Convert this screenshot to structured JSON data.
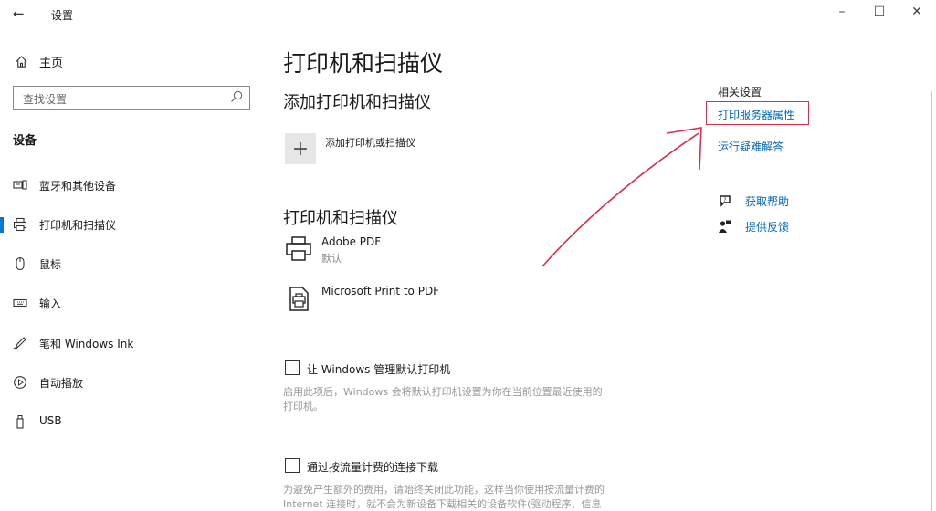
{
  "window": {
    "back_glyph": "←",
    "title": "设置",
    "minimize_glyph": "–",
    "maximize_glyph": "☐",
    "close_glyph": "✕"
  },
  "nav": {
    "home_label": "主页",
    "search_placeholder": "查找设置",
    "section_label": "设备",
    "items": [
      {
        "label": "蓝牙和其他设备",
        "icon": "keyboard-phone-icon"
      },
      {
        "label": "打印机和扫描仪",
        "icon": "printer-icon",
        "active": true
      },
      {
        "label": "鼠标",
        "icon": "mouse-icon"
      },
      {
        "label": "输入",
        "icon": "keyboard-icon"
      },
      {
        "label": "笔和 Windows Ink",
        "icon": "pen-icon"
      },
      {
        "label": "自动播放",
        "icon": "autoplay-icon"
      },
      {
        "label": "USB",
        "icon": "usb-icon"
      }
    ]
  },
  "main": {
    "page_title": "打印机和扫描仪",
    "add_section_title": "添加打印机和扫描仪",
    "add_glyph": "+",
    "add_label": "添加打印机或扫描仪",
    "printers_section_title": "打印机和扫描仪",
    "printers": [
      {
        "name": "Adobe PDF",
        "status": "默认",
        "icon": "printer-icon"
      },
      {
        "name": "Microsoft Print to PDF",
        "status": "",
        "icon": "pdf-printer-icon"
      }
    ],
    "option1": {
      "label": "让 Windows 管理默认打印机",
      "desc_lines": [
        "启用此项后，Windows 会将默认打印机设置为你在当前位置最近使用的",
        "打印机。"
      ]
    },
    "option2": {
      "label": "通过按流量计费的连接下载",
      "desc_lines": [
        "为避免产生额外的费用，请始终关闭此功能，这样当你使用按流量计费的",
        "Internet 连接时，就不会为新设备下载相关的设备软件(驱动程序、信息"
      ]
    }
  },
  "related": {
    "heading": "相关设置",
    "print_server_link": "打印服务器属性",
    "troubleshoot_link": "运行疑难解答",
    "help_link": "获取帮助",
    "feedback_link": "提供反馈"
  },
  "colors": {
    "accent": "#0078d4",
    "link": "#0067c0",
    "annotation_red": "#d9304a"
  }
}
